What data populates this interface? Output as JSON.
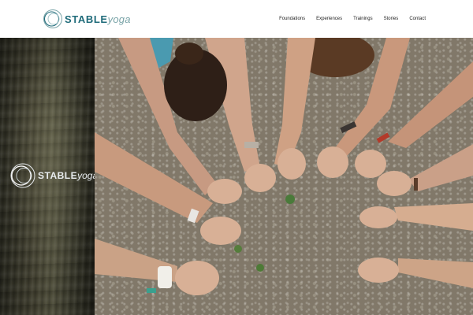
{
  "header": {
    "logo": {
      "strong": "STABLE",
      "light": "yoga"
    },
    "nav": {
      "items": [
        {
          "label": "Foundations"
        },
        {
          "label": "Experiences"
        },
        {
          "label": "Trainings"
        },
        {
          "label": "Stories"
        },
        {
          "label": "Contact"
        }
      ]
    }
  },
  "hero": {
    "overlay_logo": {
      "strong": "STABLE",
      "light": "yoga"
    },
    "photo_icon": "hands-in-circle-photo"
  },
  "colors": {
    "brand": "#1f6b7a",
    "brand_light": "#7aa4a8"
  }
}
